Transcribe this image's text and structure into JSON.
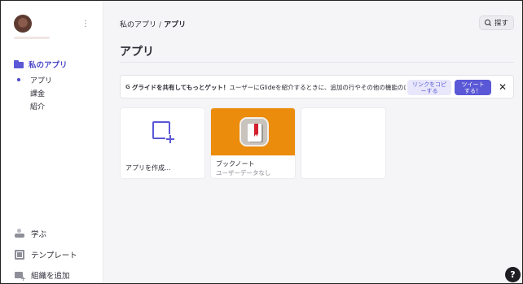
{
  "sidebar": {
    "menu_glyph": "⋮",
    "main_item": {
      "label": "私のアプリ",
      "icon": "folder-icon",
      "color": "#4a47c9"
    },
    "sub_items": [
      {
        "label": "アプリ",
        "active": true
      },
      {
        "label": "課金",
        "active": false
      },
      {
        "label": "紹介",
        "active": false
      }
    ],
    "bottom_items": [
      {
        "label": "学ぶ",
        "icon": "learn-icon"
      },
      {
        "label": "テンプレート",
        "icon": "template-icon"
      },
      {
        "label": "組織を追加",
        "icon": "add-organization-icon"
      }
    ]
  },
  "header": {
    "breadcrumb_root": "私のアプリ",
    "breadcrumb_sep": "/",
    "breadcrumb_current": "アプリ",
    "search_label": "探す",
    "page_title": "アプリ"
  },
  "banner": {
    "icon_glyph": "G",
    "bold_text": "グライドを共有してもっとゲット！",
    "body_text": "ユーザーにGlideを紹介するときに、追加の行やその他の機能のロックを...",
    "copy_button_line1": "リンクをコピ",
    "copy_button_line2": "ーする",
    "tweet_button_line1": "ツイート",
    "tweet_button_line2": "する！",
    "close_glyph": "✕"
  },
  "cards": [
    {
      "kind": "create",
      "caption": "アプリを作成..."
    },
    {
      "kind": "app",
      "caption": "ブックノート",
      "subcaption": "ユーザーデータなし",
      "thumb_color": "#ec8c0c"
    },
    {
      "kind": "empty"
    }
  ],
  "help": {
    "glyph": "?"
  },
  "colors": {
    "accent": "#5a58d6",
    "main_bg": "#f5f5f7"
  }
}
